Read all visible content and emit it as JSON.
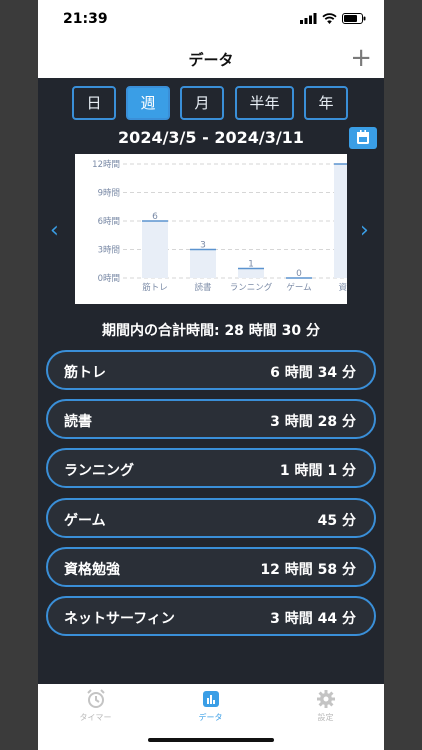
{
  "status": {
    "time": "21:39"
  },
  "nav": {
    "title": "データ",
    "add_symbol": "+"
  },
  "periods": [
    {
      "label": "日",
      "active": false
    },
    {
      "label": "週",
      "active": true
    },
    {
      "label": "月",
      "active": false
    },
    {
      "label": "半年",
      "active": false
    },
    {
      "label": "年",
      "active": false
    }
  ],
  "date_range": "2024/3/5 - 2024/3/11",
  "chart_data": {
    "type": "bar",
    "categories": [
      "筋トレ",
      "読書",
      "ランニング",
      "ゲーム",
      "資格"
    ],
    "values": [
      6,
      3,
      1,
      0,
      12
    ],
    "data_labels": [
      "6",
      "3",
      "1",
      "0",
      ""
    ],
    "yticks": [
      "0時間",
      "3時間",
      "6時間",
      "9時間",
      "12時間"
    ],
    "ylim": [
      0,
      12
    ],
    "grid": true
  },
  "total": "期間内の合計時間: 28 時間 30 分",
  "activities": [
    {
      "name": "筋トレ",
      "duration": "6 時間 34 分"
    },
    {
      "name": "読書",
      "duration": "3 時間 28 分"
    },
    {
      "name": "ランニング",
      "duration": "1 時間 1 分"
    },
    {
      "name": "ゲーム",
      "duration": "45 分"
    },
    {
      "name": "資格勉強",
      "duration": "12 時間 58 分"
    },
    {
      "name": "ネットサーフィン",
      "duration": "3 時間 44 分"
    }
  ],
  "tabs": [
    {
      "label": "タイマー",
      "icon": "alarm-clock-icon",
      "active": false
    },
    {
      "label": "データ",
      "icon": "bar-chart-icon",
      "active": true
    },
    {
      "label": "設定",
      "icon": "gear-icon",
      "active": false
    }
  ],
  "colors": {
    "accent": "#3a9ee6",
    "background": "#22262e",
    "bar": "#e8eef7"
  }
}
